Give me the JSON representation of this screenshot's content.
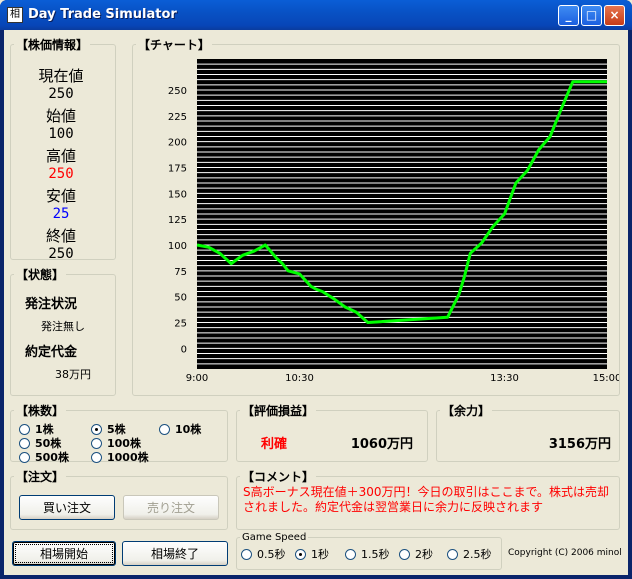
{
  "window": {
    "title": "Day Trade Simulator",
    "icon_glyph": "相",
    "buttons": {
      "minimize": "_",
      "maximize": "□",
      "close": "×"
    }
  },
  "stock_info": {
    "title": "【株価情報】",
    "items": [
      {
        "label": "現在値",
        "value": "250",
        "color": "#000000"
      },
      {
        "label": "始値",
        "value": "100",
        "color": "#000000"
      },
      {
        "label": "高値",
        "value": "250",
        "color": "#ff0000"
      },
      {
        "label": "安値",
        "value": "25",
        "color": "#0000ff"
      },
      {
        "label": "終値",
        "value": "250",
        "color": "#000000"
      }
    ]
  },
  "status": {
    "title": "【状態】",
    "order_label": "発注状況",
    "order_value": "発注無し",
    "contract_label": "約定代金",
    "contract_value": "38万円"
  },
  "shares": {
    "title": "【株数】",
    "options": [
      {
        "label": "1株",
        "selected": false
      },
      {
        "label": "5株",
        "selected": true
      },
      {
        "label": "10株",
        "selected": false
      },
      {
        "label": "50株",
        "selected": false
      },
      {
        "label": "100株",
        "selected": false
      },
      {
        "label": "500株",
        "selected": false
      },
      {
        "label": "1000株",
        "selected": false
      }
    ]
  },
  "order": {
    "title": "【注文】",
    "buy_label": "買い注文",
    "sell_label": "売り注文"
  },
  "market": {
    "start_label": "相場開始",
    "end_label": "相場終了"
  },
  "pnl": {
    "title": "【評価損益】",
    "status": "利確",
    "status_color": "#ff0000",
    "amount": "1060万円"
  },
  "capacity": {
    "title": "【余力】",
    "amount": "3156万円"
  },
  "comment": {
    "title": "【コメント】",
    "text": "S高ボーナス現在値＋300万円！今日の取引はここまで。株式は売却されました。約定代金は翌営業日に余力に反映されます",
    "color": "#ff0000"
  },
  "game_speed": {
    "title": "Game Speed",
    "options": [
      {
        "label": "0.5秒",
        "selected": false
      },
      {
        "label": "1秒",
        "selected": true
      },
      {
        "label": "1.5秒",
        "selected": false
      },
      {
        "label": "2秒",
        "selected": false
      },
      {
        "label": "2.5秒",
        "selected": false
      }
    ]
  },
  "copyright": "Copyright (C) 2006 minol",
  "chart": {
    "title": "【チャート】",
    "background": "#000000",
    "grid_color": "#ffffff",
    "line_color": "#00ff00"
  },
  "chart_data": {
    "type": "line",
    "title": "",
    "xlabel": "",
    "ylabel": "",
    "x_ticks": [
      "9:00",
      "10:30",
      "13:30",
      "15:00"
    ],
    "y_ticks": [
      0,
      25,
      50,
      75,
      100,
      125,
      150,
      175,
      200,
      225,
      250
    ],
    "ylim": [
      -20,
      280
    ],
    "xlim": [
      "9:00",
      "15:00"
    ],
    "grid": true,
    "series": [
      {
        "x": [
          "9:00",
          "9:10",
          "9:20",
          "9:30",
          "9:40",
          "9:50",
          "10:00",
          "10:10",
          "10:15",
          "10:20",
          "10:30",
          "10:40",
          "10:45",
          "10:50",
          "11:00",
          "11:10",
          "11:20",
          "11:30",
          "12:40",
          "12:50",
          "12:55",
          "13:00",
          "13:10",
          "13:20",
          "13:30",
          "13:40",
          "13:50",
          "14:00",
          "14:10",
          "14:20",
          "14:30",
          "14:40",
          "14:45",
          "15:00"
        ],
        "values": [
          100,
          98,
          92,
          82,
          90,
          94,
          100,
          87,
          82,
          75,
          72,
          60,
          57,
          55,
          48,
          40,
          35,
          25,
          30,
          52,
          70,
          92,
          102,
          118,
          130,
          160,
          172,
          192,
          205,
          232,
          258,
          258,
          258,
          258
        ]
      }
    ]
  }
}
